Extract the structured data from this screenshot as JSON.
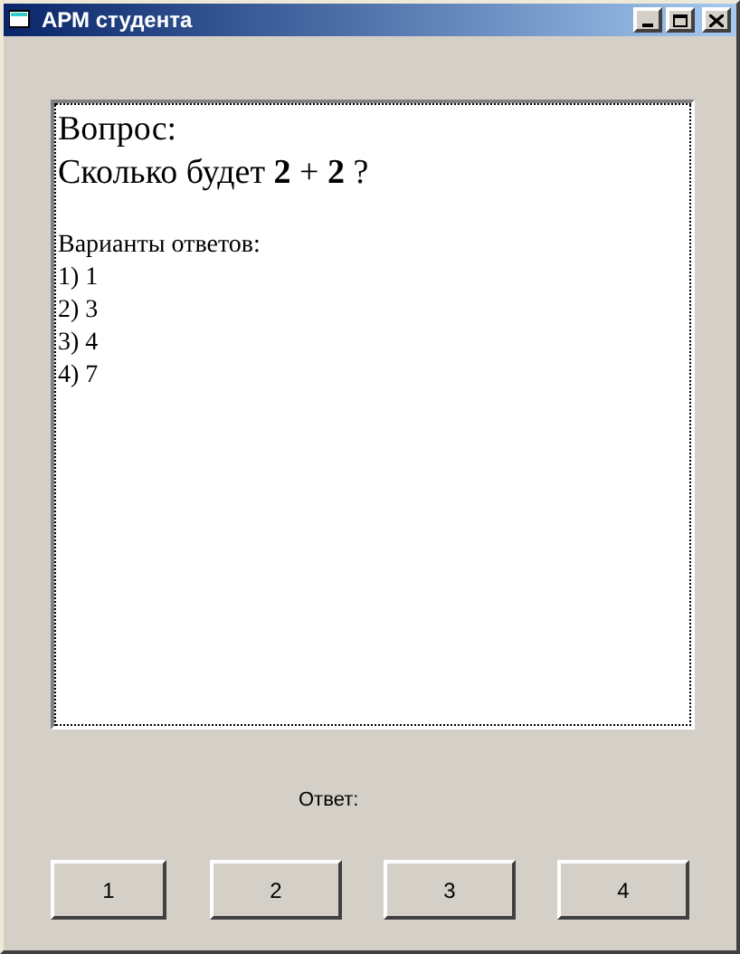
{
  "window": {
    "title": "АРМ студента"
  },
  "question": {
    "heading": "Вопрос:",
    "text": "Сколько будет **2** + **2** ?",
    "options_heading": "Варианты ответов:",
    "options": [
      "1) 1",
      "2) 3",
      "3) 4",
      "4) 7"
    ]
  },
  "answer_label": "Ответ:",
  "buttons": [
    "1",
    "2",
    "3",
    "4"
  ]
}
